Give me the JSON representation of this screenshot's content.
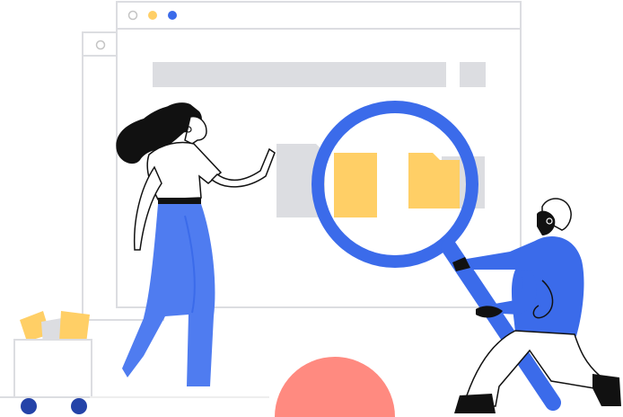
{
  "illustration": {
    "subject": "file-search-illustration",
    "colors": {
      "outline": "#dcdde1",
      "placeholder": "#dcdde1",
      "folder": "#ffcf66",
      "accent_blue": "#3b6bea",
      "pants_blue": "#4f7cf0",
      "dark": "#111111",
      "semicircle": "#ff8a80",
      "cart_wheel": "#2443a8",
      "window_dot_outline": "#c4c4c4",
      "window_dot_yellow": "#ffcf66",
      "window_dot_blue": "#3b6bea"
    },
    "icons": [
      "magnifying-glass-icon",
      "folder-icon",
      "window-control-dots"
    ]
  }
}
